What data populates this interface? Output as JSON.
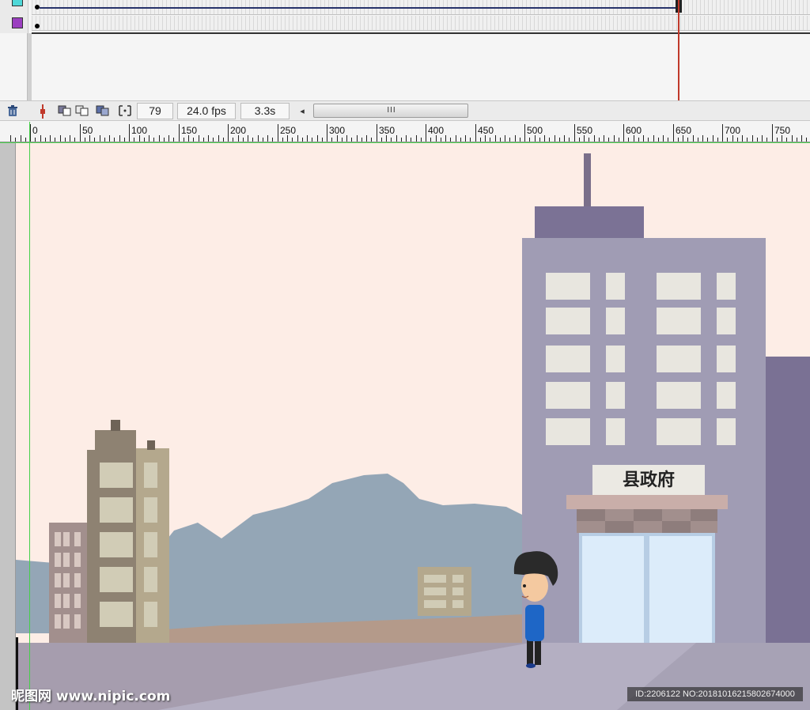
{
  "status_bar": {
    "frame_number": "79",
    "frame_rate": "24.0 fps",
    "elapsed_time": "3.3s",
    "scroll_left_arrow": "◂",
    "scroll_grip": "III"
  },
  "ruler": {
    "labels": [
      "0",
      "50",
      "100",
      "150",
      "200",
      "250",
      "300",
      "350",
      "400",
      "450",
      "500",
      "550",
      "600",
      "650",
      "700",
      "750"
    ]
  },
  "layers": [
    {
      "color": "#4fd8d8"
    },
    {
      "color": "#9b3fc0"
    }
  ],
  "scene": {
    "sign_text": "县政府"
  },
  "watermark": {
    "site": "昵图网 www.nipic.com",
    "id_text": "ID:2206122 NO:20181016215802674000"
  }
}
